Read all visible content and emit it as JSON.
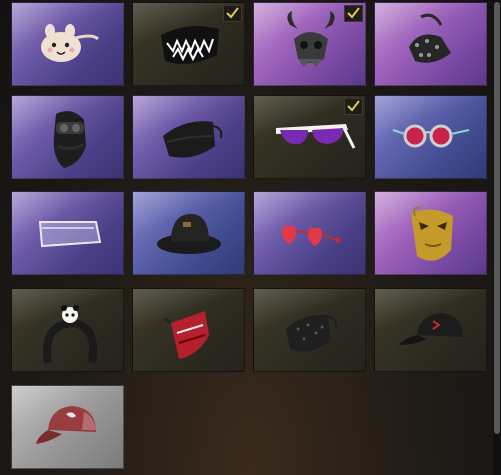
{
  "inventory": {
    "slots": [
      {
        "name": "plush-bunny-mask",
        "equipped": false,
        "rarity_color": "purple"
      },
      {
        "name": "shark-teeth-face-mask",
        "equipped": true,
        "rarity_color": "olive"
      },
      {
        "name": "horned-mask",
        "equipped": true,
        "rarity_color": "magenta"
      },
      {
        "name": "spiked-leather-muzzle",
        "equipped": false,
        "rarity_color": "magenta"
      },
      {
        "name": "balaclava-goggles",
        "equipped": false,
        "rarity_color": "purple"
      },
      {
        "name": "black-cloth-mask",
        "equipped": false,
        "rarity_color": "purple"
      },
      {
        "name": "white-purple-sunglasses",
        "equipped": true,
        "rarity_color": "olive"
      },
      {
        "name": "round-red-glasses",
        "equipped": false,
        "rarity_color": "blue"
      },
      {
        "name": "clear-face-shield",
        "equipped": false,
        "rarity_color": "purple"
      },
      {
        "name": "black-bucket-hat",
        "equipped": false,
        "rarity_color": "blue"
      },
      {
        "name": "heart-sunglasses",
        "equipped": false,
        "rarity_color": "purple"
      },
      {
        "name": "gold-masquerade-mask",
        "equipped": false,
        "rarity_color": "magenta"
      },
      {
        "name": "panda-headband",
        "equipped": false,
        "rarity_color": "olive"
      },
      {
        "name": "red-tech-mask",
        "equipped": false,
        "rarity_color": "olive"
      },
      {
        "name": "black-patterned-mask",
        "equipped": false,
        "rarity_color": "olive"
      },
      {
        "name": "black-baseball-cap",
        "equipped": false,
        "rarity_color": "olive"
      },
      {
        "name": "red-baseball-cap",
        "equipped": false,
        "rarity_color": "gray"
      }
    ],
    "scrollbar": {
      "position": "top"
    }
  }
}
